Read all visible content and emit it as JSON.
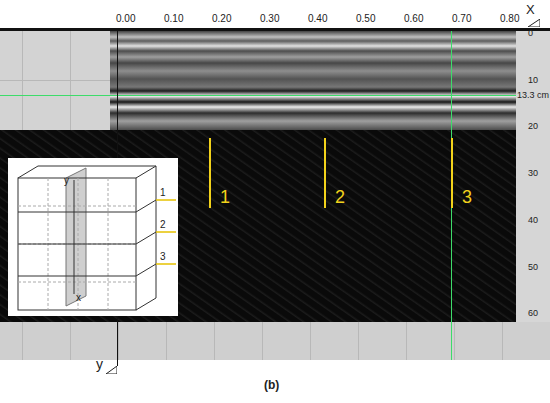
{
  "figure": {
    "x_axis": {
      "label": "X",
      "ticks": [
        "0.00",
        "0.10",
        "0.20",
        "0.30",
        "0.40",
        "0.50",
        "0.60",
        "0.70",
        "0.80"
      ]
    },
    "y_axis": {
      "label": "y",
      "ticks": [
        "0",
        "10",
        "20",
        "30",
        "40",
        "50",
        "60"
      ],
      "marker": "13.3 cm"
    },
    "markers": [
      {
        "label": "1"
      },
      {
        "label": "2"
      },
      {
        "label": "3"
      }
    ],
    "inset": {
      "slices": [
        "1",
        "2",
        "3"
      ],
      "axis_y": "y",
      "axis_x": "x"
    },
    "caption": "(b)"
  }
}
